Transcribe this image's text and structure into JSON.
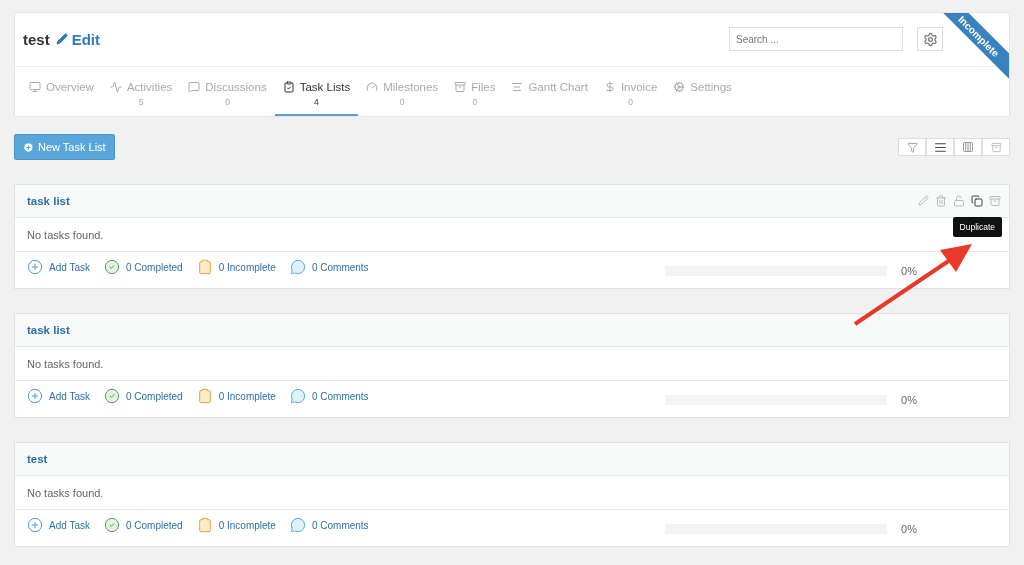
{
  "project": {
    "title": "test",
    "edit_label": "Edit",
    "search_placeholder": "Search ...",
    "ribbon": "Incomplete"
  },
  "tabs": [
    {
      "label": "Overview",
      "selected": false
    },
    {
      "label": "Activities",
      "count": "5",
      "selected": false
    },
    {
      "label": "Discussions",
      "count": "0",
      "selected": false
    },
    {
      "label": "Task Lists",
      "count": "4",
      "selected": true
    },
    {
      "label": "Milestones",
      "count": "0",
      "selected": false
    },
    {
      "label": "Files",
      "count": "0",
      "selected": false
    },
    {
      "label": "Gantt Chart",
      "selected": false
    },
    {
      "label": "Invoice",
      "count": "0",
      "selected": false
    },
    {
      "label": "Settings",
      "selected": false
    }
  ],
  "new_button": "New Task List",
  "task_lists": [
    {
      "title": "task list",
      "hovered": true,
      "tooltip": "Duplicate",
      "empty_text": "No tasks found.",
      "add_label": "Add Task",
      "completed": "0 Completed",
      "incomplete": "0 Incomplete",
      "comments": "0 Comments",
      "level": 0,
      "reading": "0%"
    },
    {
      "title": "task list",
      "hovered": false,
      "empty_text": "No tasks found.",
      "add_label": "Add Task",
      "completed": "0 Completed",
      "incomplete": "0 Incomplete",
      "comments": "0 Comments",
      "level": 0,
      "reading": "0%"
    },
    {
      "title": "test",
      "hovered": false,
      "empty_text": "No tasks found.",
      "add_label": "Add Task",
      "completed": "0 Completed",
      "incomplete": "0 Incomplete",
      "comments": "0 Comments",
      "level": 0,
      "reading": "0%"
    }
  ]
}
